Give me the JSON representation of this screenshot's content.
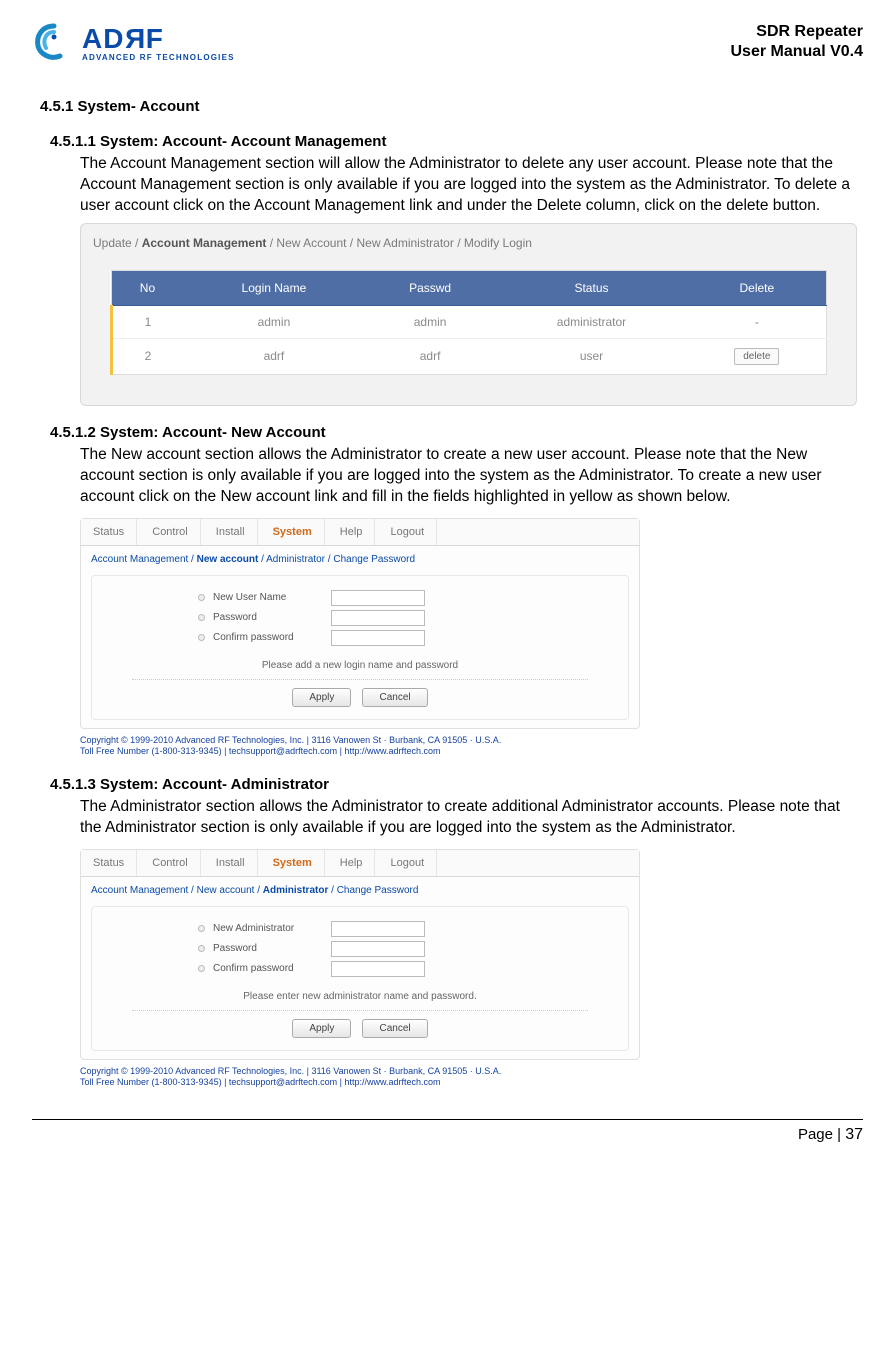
{
  "header": {
    "logo_text_1": "AD",
    "logo_text_r": "R",
    "logo_text_2": "F",
    "logo_sub": "ADVANCED RF TECHNOLOGIES",
    "doc_title_line1": "SDR Repeater",
    "doc_title_line2": "User Manual V0.4"
  },
  "sections": {
    "s451": {
      "num_title": "4.5.1 System- Account",
      "s4511": {
        "num_title": "4.5.1.1 System: Account- Account Management",
        "body": "The Account Management section will allow the Administrator to delete any user account.   Please note that the Account Management section is only available if you are logged into the system as the Administrator.   To delete a user account click on the Account Management link and under the Delete column, click on the delete button."
      },
      "s4512": {
        "num_title": "4.5.1.2 System: Account- New Account",
        "body": "The New account section allows the Administrator to create a new user account.   Please note that the New account section is only available if you are logged into the system as the Administrator.   To create a new user account click on the New account link and fill in the fields highlighted in yellow as shown below."
      },
      "s4513": {
        "num_title": "4.5.1.3 System: Account- Administrator",
        "body": "The Administrator section allows the Administrator to create additional Administrator accounts.   Please note that the Administrator section is only available if you are logged into the system as the Administrator."
      }
    }
  },
  "ui_acct_mgmt": {
    "breadcrumb": [
      "Update",
      "Account Management",
      "New Account",
      "New Administrator",
      "Modify Login"
    ],
    "active_bc_index": 1,
    "cols": [
      "No",
      "Login Name",
      "Passwd",
      "Status",
      "Delete"
    ],
    "rows": [
      {
        "no": "1",
        "login": "admin",
        "passwd": "admin",
        "status": "administrator",
        "delete": "-"
      },
      {
        "no": "2",
        "login": "adrf",
        "passwd": "adrf",
        "status": "user",
        "delete": "delete"
      }
    ]
  },
  "ui_tabs": [
    "Status",
    "Control",
    "Install",
    "System",
    "Help",
    "Logout"
  ],
  "ui_new_acct": {
    "mini_bc": [
      "Account Management",
      "New account",
      "Administrator",
      "Change Password"
    ],
    "active_bc_index": 1,
    "fields": [
      "New User Name",
      "Password",
      "Confirm password"
    ],
    "msg": "Please add a new login name and password",
    "apply": "Apply",
    "cancel": "Cancel"
  },
  "ui_admin": {
    "mini_bc": [
      "Account Management",
      "New account",
      "Administrator",
      "Change Password"
    ],
    "active_bc_index": 2,
    "fields": [
      "New Administrator",
      "Password",
      "Confirm password"
    ],
    "msg": "Please enter new administrator name and password.",
    "apply": "Apply",
    "cancel": "Cancel"
  },
  "footer_copyright": "Copyright © 1999-2010 Advanced RF Technologies, Inc. | 3116 Vanowen St · Burbank, CA 91505 · U.S.A.",
  "footer_support": "Toll Free Number (1-800-313-9345) | techsupport@adrftech.com | http://www.adrftech.com",
  "page_footer": {
    "label": "Page | ",
    "num": "37"
  }
}
